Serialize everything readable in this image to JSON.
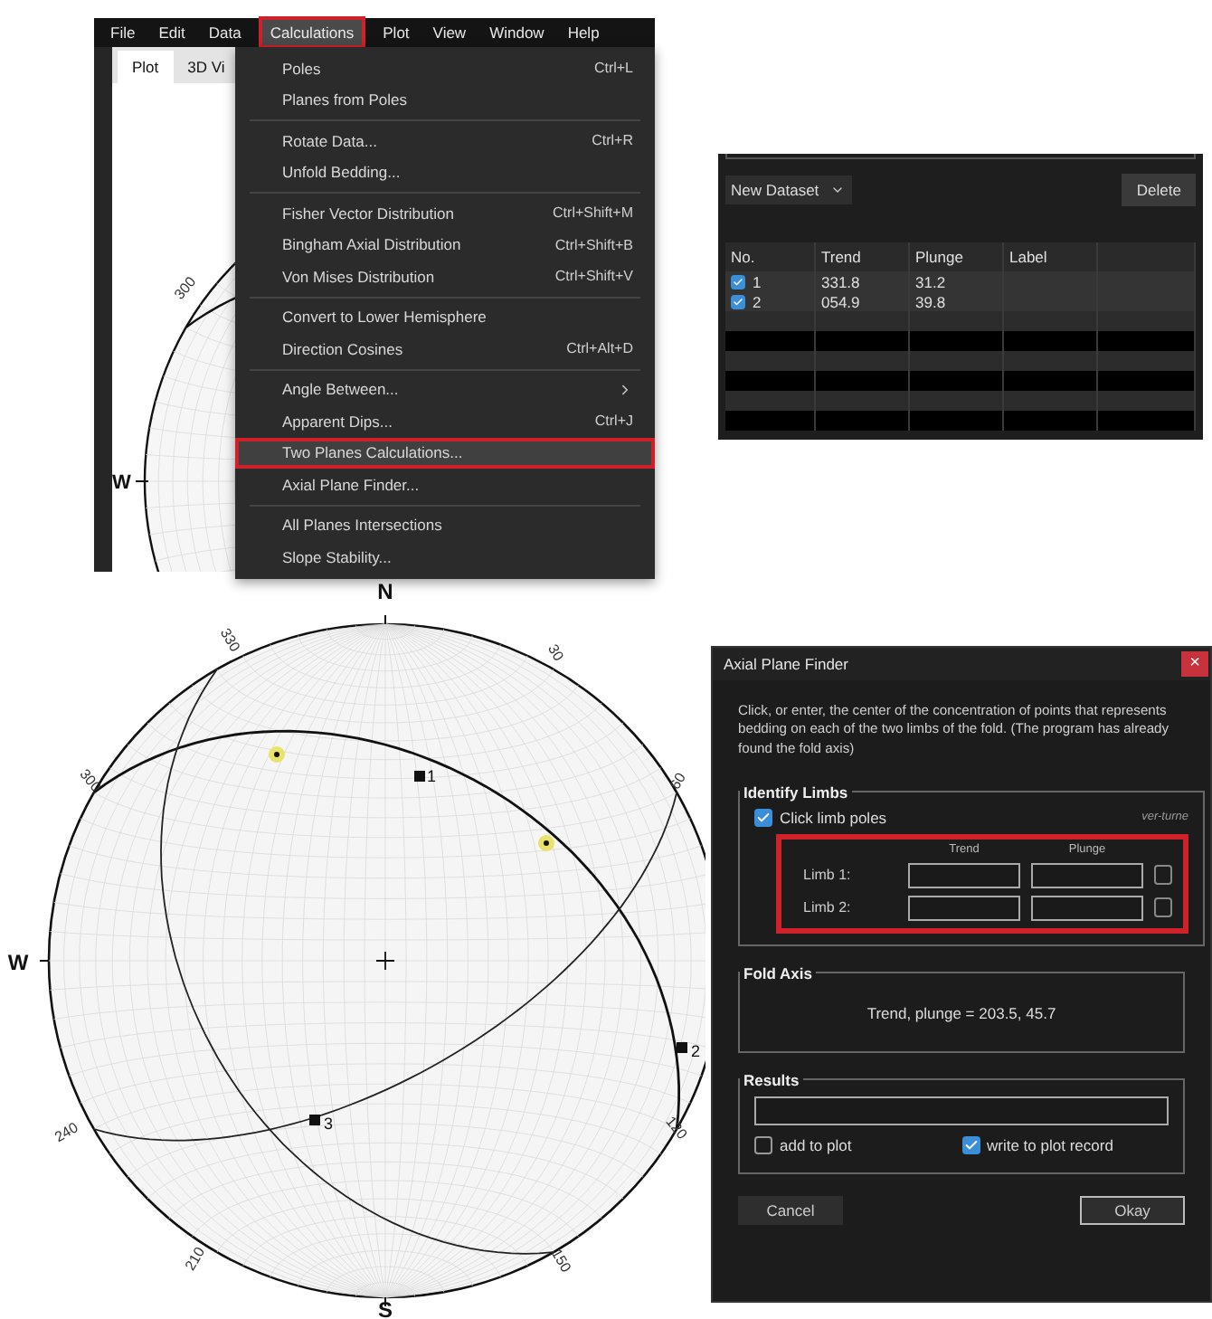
{
  "main_window": {
    "menu_bar": [
      {
        "label": "File",
        "selected": false,
        "outlined": false
      },
      {
        "label": "Edit",
        "selected": false,
        "outlined": false
      },
      {
        "label": "Data",
        "selected": false,
        "outlined": false
      },
      {
        "label": "Calculations",
        "selected": true,
        "outlined": true
      },
      {
        "label": "Plot",
        "selected": false,
        "outlined": false
      },
      {
        "label": "View",
        "selected": false,
        "outlined": false
      },
      {
        "label": "Window",
        "selected": false,
        "outlined": false
      },
      {
        "label": "Help",
        "selected": false,
        "outlined": false
      }
    ],
    "tabs": [
      {
        "label": "Plot",
        "selected": true
      },
      {
        "label": "3D Vi",
        "selected": false
      }
    ],
    "plot_labels": [
      "300",
      "W"
    ],
    "menu_groups": [
      {
        "items": [
          {
            "label": "Poles",
            "shortcut": "Ctrl+L",
            "submenu": false,
            "highlighted": false,
            "outlined": false
          },
          {
            "label": "Planes from Poles",
            "submenu": false,
            "highlighted": false,
            "outlined": false
          }
        ]
      },
      {
        "items": [
          {
            "label": "Rotate Data...",
            "shortcut": "Ctrl+R",
            "submenu": false,
            "highlighted": false,
            "outlined": false
          },
          {
            "label": "Unfold Bedding...",
            "submenu": false,
            "highlighted": false,
            "outlined": false
          }
        ]
      },
      {
        "items": [
          {
            "label": "Fisher Vector Distribution",
            "shortcut": "Ctrl+Shift+M",
            "submenu": false,
            "highlighted": false,
            "outlined": false
          },
          {
            "label": "Bingham Axial Distribution",
            "shortcut": "Ctrl+Shift+B",
            "submenu": false,
            "highlighted": false,
            "outlined": false
          },
          {
            "label": "Von Mises Distribution",
            "shortcut": "Ctrl+Shift+V",
            "submenu": false,
            "highlighted": false,
            "outlined": false
          }
        ]
      },
      {
        "items": [
          {
            "label": "Convert to Lower Hemisphere",
            "submenu": false,
            "highlighted": false,
            "outlined": false
          },
          {
            "label": "Direction Cosines",
            "shortcut": "Ctrl+Alt+D",
            "submenu": false,
            "highlighted": false,
            "outlined": false
          }
        ]
      },
      {
        "items": [
          {
            "label": "Angle Between...",
            "submenu": true,
            "highlighted": false,
            "outlined": false
          },
          {
            "label": "Apparent Dips...",
            "shortcut": "Ctrl+J",
            "submenu": false,
            "highlighted": false,
            "outlined": false
          },
          {
            "label": "Two Planes Calculations...",
            "submenu": false,
            "highlighted": true,
            "outlined": true
          },
          {
            "label": "Axial Plane Finder...",
            "submenu": false,
            "highlighted": false,
            "outlined": false
          }
        ]
      },
      {
        "items": [
          {
            "label": "All Planes Intersections",
            "submenu": false,
            "highlighted": false,
            "outlined": false
          },
          {
            "label": "Slope Stability...",
            "submenu": false,
            "highlighted": false,
            "outlined": false
          }
        ]
      }
    ]
  },
  "dataset_panel": {
    "dataset_select": "New Dataset",
    "delete_button": "Delete",
    "columns": [
      "No.",
      "Trend",
      "Plunge",
      "Label"
    ],
    "rows": [
      {
        "no": "1",
        "checked": true,
        "trend": "331.8",
        "plunge": "31.2"
      },
      {
        "no": "2",
        "checked": true,
        "trend": "054.9",
        "plunge": "39.8"
      }
    ]
  },
  "stereonet": {
    "cardinals": [
      "N",
      "W",
      "S"
    ],
    "ticks": [
      "330",
      "30",
      "300",
      "60",
      "240",
      "120",
      "210",
      "150"
    ],
    "points": [
      "1",
      "2",
      "3"
    ]
  },
  "dialog": {
    "title": "Axial Plane Finder",
    "close": "×",
    "description": "Click, or enter, the center of the concentration of points that represents bedding on each of the two limbs of the fold. (The program has already found the fold axis)",
    "identify_limbs": {
      "title": "Identify Limbs",
      "click_poles": {
        "label": "Click limb poles",
        "checked": true
      },
      "overturned_heading": "ver-turne",
      "column_headings": [
        "Trend",
        "Plunge"
      ],
      "outlined": true,
      "limbs": [
        {
          "label": "Limb 1:",
          "overturned": false
        },
        {
          "label": "Limb 2:",
          "overturned": false
        }
      ]
    },
    "fold_axis": {
      "title": "Fold Axis",
      "result": "Trend, plunge = 203.5, 45.7"
    },
    "results": {
      "title": "Results",
      "options": [
        {
          "label": "add to plot",
          "checked": false
        },
        {
          "label": "write to plot record",
          "checked": true
        }
      ]
    },
    "buttons": [
      {
        "label": "Cancel",
        "default": false
      },
      {
        "label": "Okay",
        "default": true
      }
    ]
  }
}
